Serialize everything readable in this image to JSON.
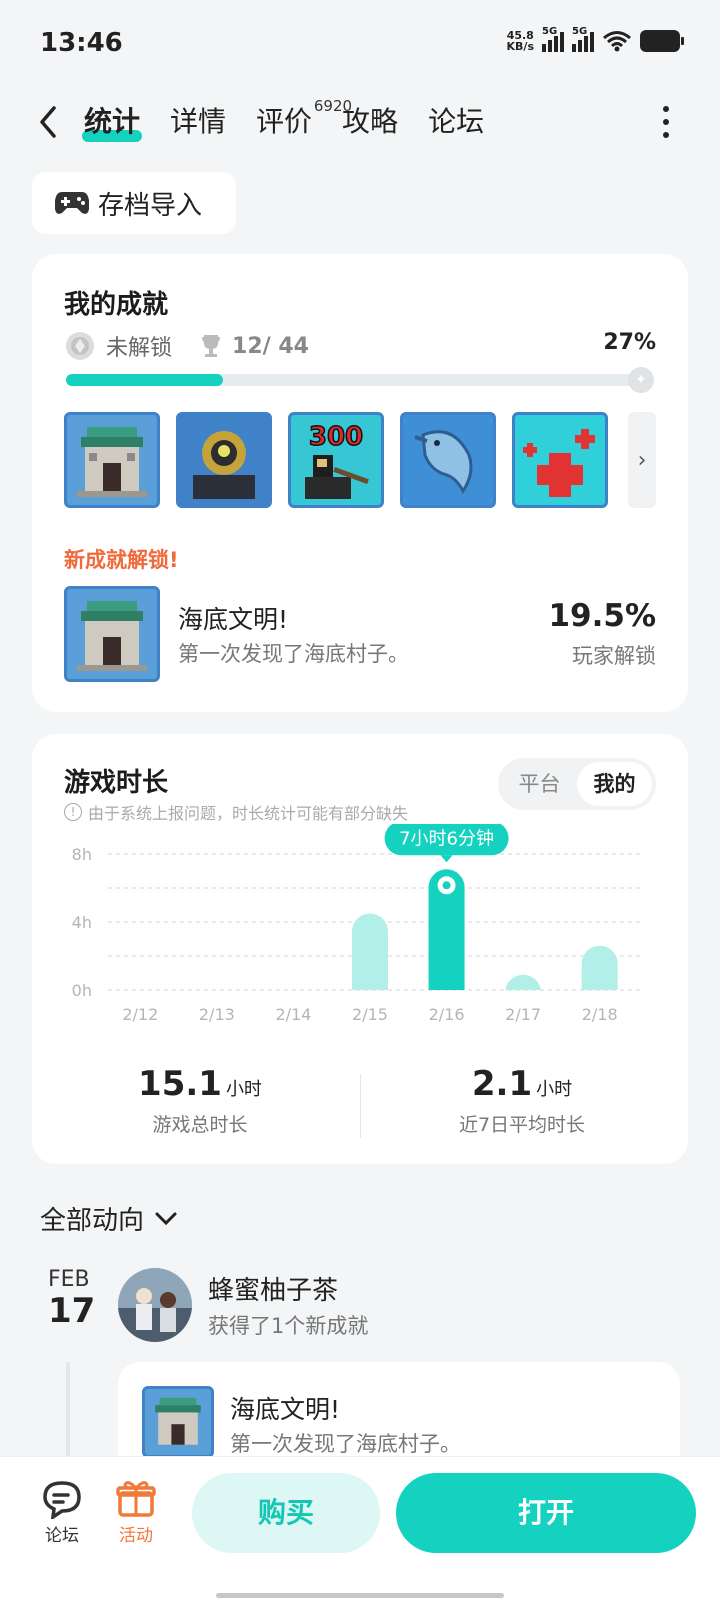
{
  "status": {
    "time": "13:46",
    "speed_value": "45.8",
    "speed_unit": "KB/s",
    "net1": "5G",
    "net2": "5G"
  },
  "nav": {
    "tabs": [
      {
        "label": "统计"
      },
      {
        "label": "详情"
      },
      {
        "label": "评价",
        "badge": "6920"
      },
      {
        "label": "攻略"
      },
      {
        "label": "论坛"
      }
    ]
  },
  "import_label": "存档导入",
  "achievements": {
    "title": "我的成就",
    "locked_label": "未解锁",
    "count": "12/ 44",
    "percent": "27%",
    "progress": 0.27,
    "new_label": "新成就解锁!",
    "new_item": {
      "name": "海底文明!",
      "desc": "第一次发现了海底村子。",
      "rate": "19.5%",
      "rate_label": "玩家解锁"
    },
    "badge_300": "300"
  },
  "playtime": {
    "title": "游戏时长",
    "note": "由于系统上报问题，时长统计可能有部分缺失",
    "toggle": [
      "平台",
      "我的"
    ],
    "tooltip": "7小时6分钟",
    "total_value": "15.1",
    "total_unit": "小时",
    "total_label": "游戏总时长",
    "avg_value": "2.1",
    "avg_unit": "小时",
    "avg_label": "近7日平均时长"
  },
  "chart_data": {
    "type": "bar",
    "categories": [
      "2/12",
      "2/13",
      "2/14",
      "2/15",
      "2/16",
      "2/17",
      "2/18"
    ],
    "values": [
      0,
      0,
      0,
      4.5,
      7.1,
      0.9,
      2.6
    ],
    "ylim": [
      0,
      8
    ],
    "yticks": [
      "0h",
      "4h",
      "8h"
    ],
    "highlight_index": 4,
    "colors": {
      "highlight": "#14d2bf",
      "normal": "#b1efe8"
    }
  },
  "feed": {
    "header": "全部动向",
    "month": "FEB",
    "day": "17",
    "user": "蜂蜜柚子茶",
    "action": "获得了1个新成就",
    "item": {
      "name": "海底文明!",
      "desc": "第一次发现了海底村子。"
    }
  },
  "bottom": {
    "forum": "论坛",
    "event": "活动",
    "buy": "购买",
    "open": "打开"
  }
}
